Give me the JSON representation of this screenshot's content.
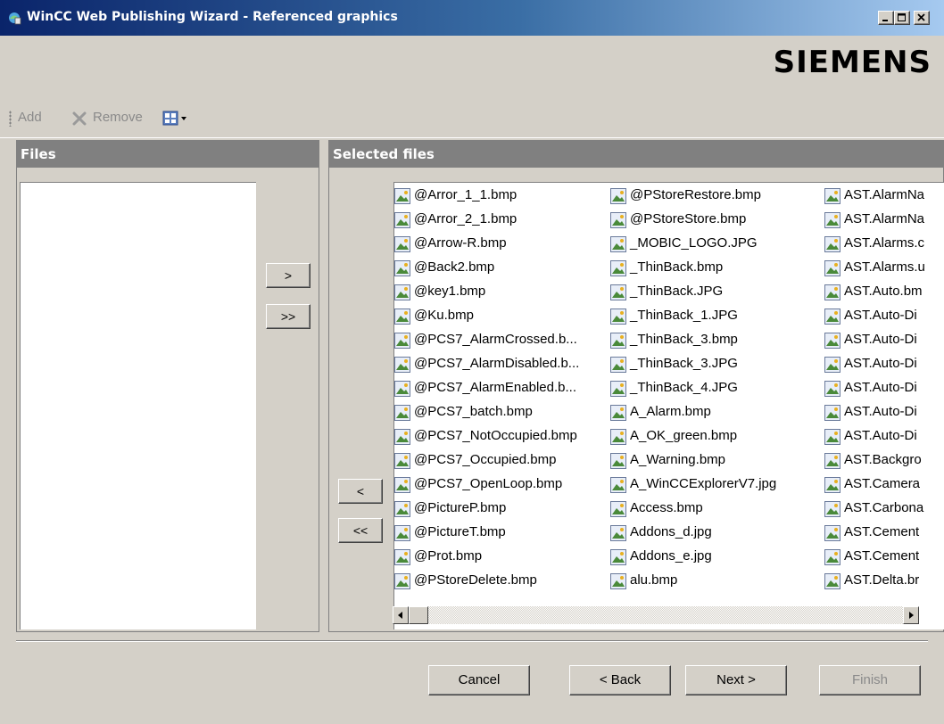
{
  "window": {
    "title": "WinCC Web Publishing Wizard - Referenced graphics",
    "minimize_icon": "minimize-icon",
    "maximize_icon": "maximize-icon",
    "close_icon": "close-icon"
  },
  "banner": {
    "logo_text": "SIEMENS"
  },
  "toolbar": {
    "add_label": "Add",
    "remove_label": "Remove",
    "remove_icon": "x-icon",
    "view_icon": "view-mode-icon"
  },
  "files_panel": {
    "header": "Files",
    "items": []
  },
  "transfer": {
    "add_one": ">",
    "add_all": ">>",
    "remove_one": "<",
    "remove_all": "<<"
  },
  "selected_panel": {
    "header": "Selected files",
    "columns": [
      [
        "@Arror_1_1.bmp",
        "@Arror_2_1.bmp",
        "@Arrow-R.bmp",
        "@Back2.bmp",
        "@key1.bmp",
        "@Ku.bmp",
        "@PCS7_AlarmCrossed.b...",
        "@PCS7_AlarmDisabled.b...",
        "@PCS7_AlarmEnabled.b...",
        "@PCS7_batch.bmp",
        "@PCS7_NotOccupied.bmp",
        "@PCS7_Occupied.bmp",
        "@PCS7_OpenLoop.bmp",
        "@PictureP.bmp",
        "@PictureT.bmp",
        "@Prot.bmp",
        "@PStoreDelete.bmp"
      ],
      [
        "@PStoreRestore.bmp",
        "@PStoreStore.bmp",
        "_MOBIC_LOGO.JPG",
        "_ThinBack.bmp",
        "_ThinBack.JPG",
        "_ThinBack_1.JPG",
        "_ThinBack_3.bmp",
        "_ThinBack_3.JPG",
        "_ThinBack_4.JPG",
        "A_Alarm.bmp",
        "A_OK_green.bmp",
        "A_Warning.bmp",
        "A_WinCCExplorerV7.jpg",
        "Access.bmp",
        "Addons_d.jpg",
        "Addons_e.jpg",
        "alu.bmp"
      ],
      [
        "AST.AlarmNa",
        "AST.AlarmNa",
        "AST.Alarms.c",
        "AST.Alarms.u",
        "AST.Auto.bm",
        "AST.Auto-Di",
        "AST.Auto-Di",
        "AST.Auto-Di",
        "AST.Auto-Di",
        "AST.Auto-Di",
        "AST.Auto-Di",
        "AST.Backgro",
        "AST.Camera",
        "AST.Carbona",
        "AST.Cement",
        "AST.Cement",
        "AST.Delta.br"
      ]
    ],
    "item_icon": "image-file-icon"
  },
  "footer": {
    "cancel_label": "Cancel",
    "back_label": "< Back",
    "next_label": "Next >",
    "finish_label": "Finish"
  }
}
